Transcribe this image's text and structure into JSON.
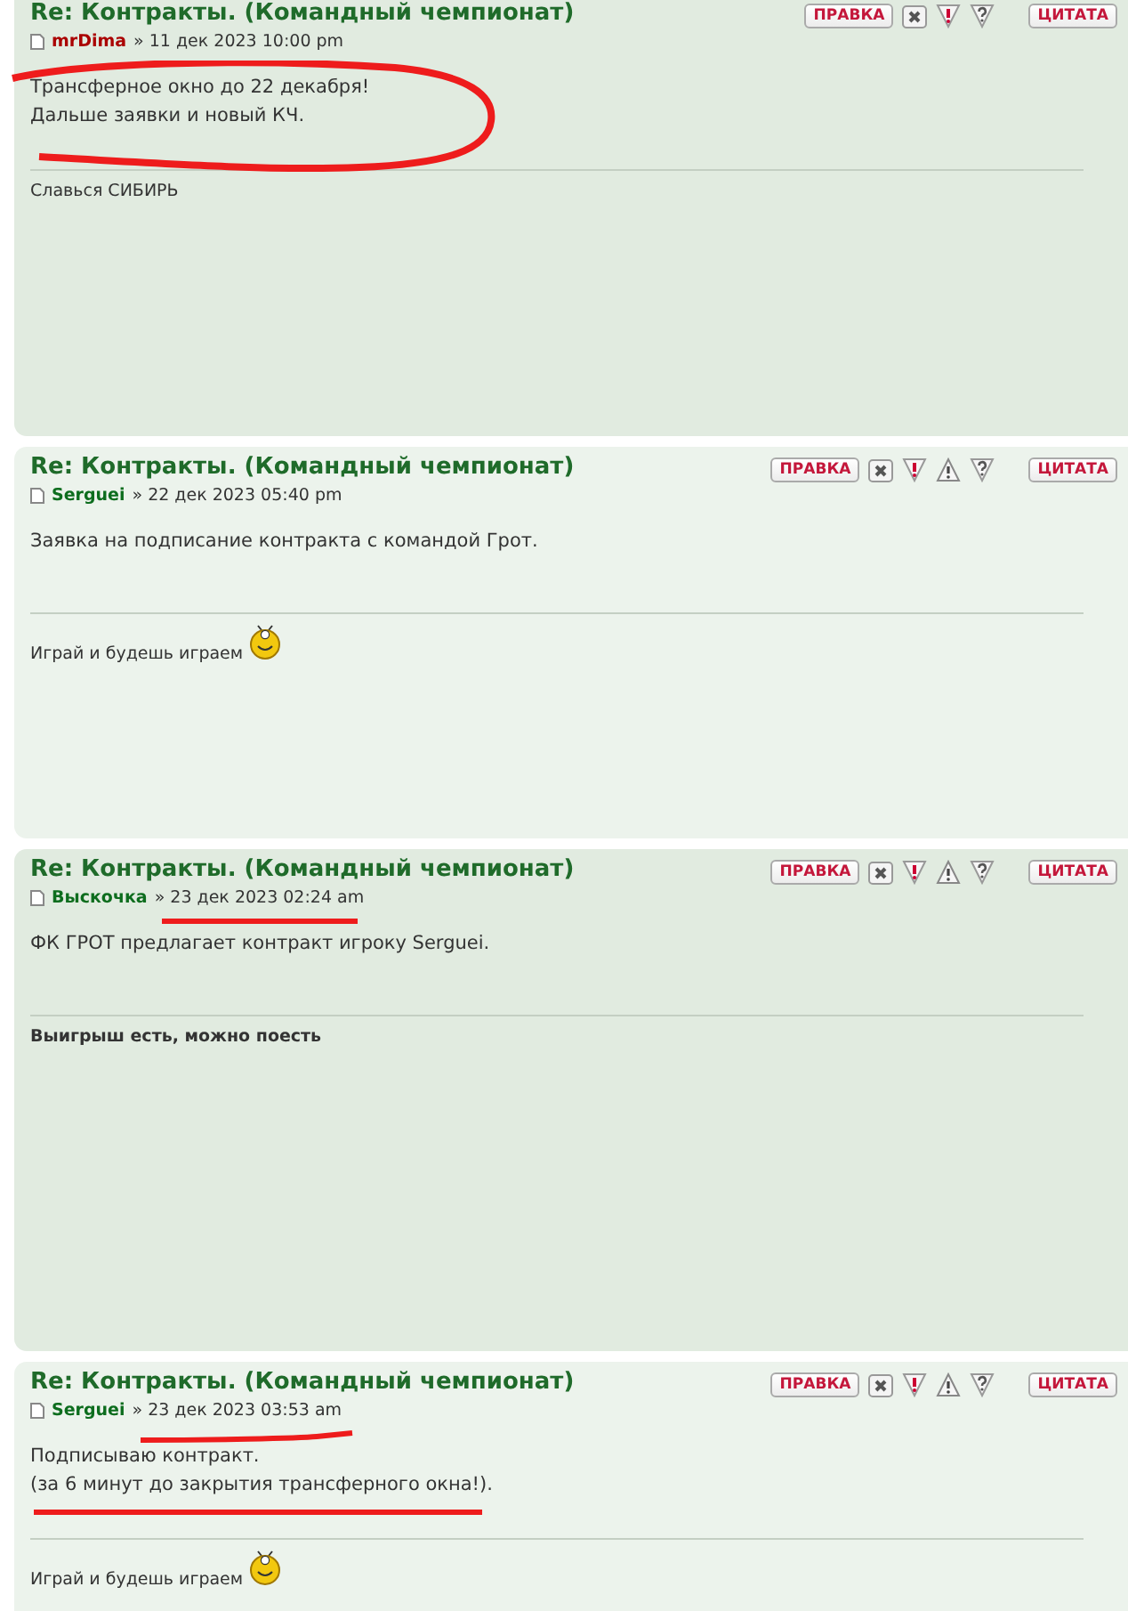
{
  "posts": [
    {
      "title": "Re: Контракты. (Командный чемпионат)",
      "author": "mrDima",
      "color": "#aa0000",
      "date": "» 11 дек 2023 10:00 pm",
      "body": [
        "Трансферное окно до 22 декабря!",
        "Дальше заявки и новый КЧ."
      ],
      "signature": "Славься СИБИРЬ",
      "signature_bold": false,
      "smiley": false,
      "buttons": [
        {
          "kind": "edit",
          "label": "ПРАВКА"
        },
        {
          "kind": "delete"
        },
        {
          "kind": "report"
        },
        {
          "kind": "info"
        },
        {
          "kind": "quote",
          "label": "ЦИТАТА"
        }
      ]
    },
    {
      "title": "Re: Контракты. (Командный чемпионат)",
      "author": "Serguei",
      "color": "#0d6d1e",
      "date": "» 22 дек 2023 05:40 pm",
      "body": [
        "Заявка на подписание контракта с командой Грот."
      ],
      "signature": "Играй и будешь играем",
      "signature_bold": false,
      "smiley": true,
      "buttons": [
        {
          "kind": "edit",
          "label": "ПРАВКА"
        },
        {
          "kind": "delete"
        },
        {
          "kind": "report"
        },
        {
          "kind": "warn"
        },
        {
          "kind": "info"
        },
        {
          "kind": "quote",
          "label": "ЦИТАТА"
        }
      ]
    },
    {
      "title": "Re: Контракты. (Командный чемпионат)",
      "author": "Выскочка",
      "color": "#0d6d1e",
      "date": "» 23 дек 2023 02:24 am",
      "body": [
        "ФК ГРОТ предлагает контракт игроку Serguei."
      ],
      "signature": "Выигрыш есть, можно поесть",
      "signature_bold": true,
      "smiley": false,
      "buttons": [
        {
          "kind": "edit",
          "label": "ПРАВКА"
        },
        {
          "kind": "delete"
        },
        {
          "kind": "report"
        },
        {
          "kind": "warn"
        },
        {
          "kind": "info"
        },
        {
          "kind": "quote",
          "label": "ЦИТАТА"
        }
      ]
    },
    {
      "title": "Re: Контракты. (Командный чемпионат)",
      "author": "Serguei",
      "color": "#0d6d1e",
      "date": "» 23 дек 2023 03:53 am",
      "body": [
        "Подписываю контракт.",
        "(за 6 минут до закрытия трансферного окна!)."
      ],
      "signature": "Играй и будешь играем",
      "signature_bold": false,
      "smiley": true,
      "buttons": [
        {
          "kind": "edit",
          "label": "ПРАВКА"
        },
        {
          "kind": "delete"
        },
        {
          "kind": "report"
        },
        {
          "kind": "warn"
        },
        {
          "kind": "info"
        },
        {
          "kind": "quote",
          "label": "ЦИТАТА"
        }
      ]
    }
  ]
}
